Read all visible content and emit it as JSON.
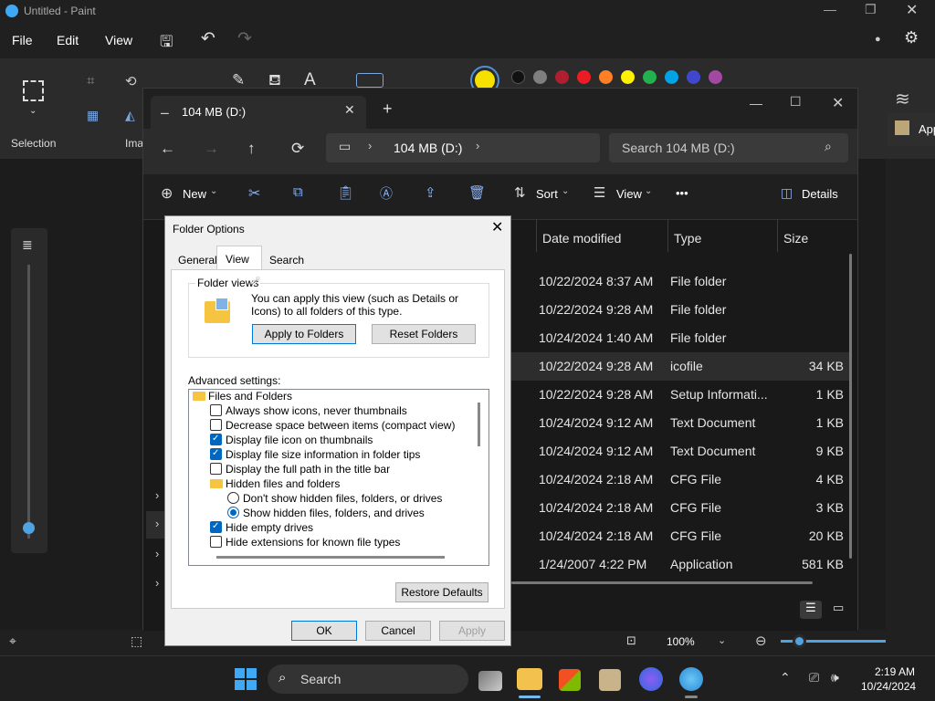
{
  "paint": {
    "title": "Untitled - Paint",
    "menu": [
      "File",
      "Edit",
      "View"
    ],
    "selection_label": "Selection",
    "image_label": "Ima",
    "zoom": "100%",
    "palette": [
      "#111111",
      "#7f7f7f",
      "#b01f2f",
      "#ed1c24",
      "#ff7f27",
      "#fff200",
      "#22b14c",
      "#00a2e8",
      "#3f48cc",
      "#a349a4"
    ],
    "primary_color": "#f5e000",
    "side_label": "App"
  },
  "explorer": {
    "tab_title": "104 MB (D:)",
    "breadcrumb": "104 MB (D:)",
    "search_placeholder": "Search 104 MB (D:)",
    "toolbar": {
      "new": "New",
      "sort": "Sort",
      "view": "View",
      "more": "•••",
      "details": "Details"
    },
    "columns": [
      "Date modified",
      "Type",
      "Size"
    ],
    "rows": [
      {
        "date": "10/22/2024 8:37 AM",
        "type": "File folder",
        "size": ""
      },
      {
        "date": "10/22/2024 9:28 AM",
        "type": "File folder",
        "size": ""
      },
      {
        "date": "10/24/2024 1:40 AM",
        "type": "File folder",
        "size": ""
      },
      {
        "date": "10/22/2024 9:28 AM",
        "type": "icofile",
        "size": "34 KB"
      },
      {
        "date": "10/22/2024 9:28 AM",
        "type": "Setup Informati...",
        "size": "1 KB"
      },
      {
        "date": "10/24/2024 9:12 AM",
        "type": "Text Document",
        "size": "1 KB"
      },
      {
        "date": "10/24/2024 9:12 AM",
        "type": "Text Document",
        "size": "9 KB"
      },
      {
        "date": "10/24/2024 2:18 AM",
        "type": "CFG File",
        "size": "4 KB"
      },
      {
        "date": "10/24/2024 2:18 AM",
        "type": "CFG File",
        "size": "3 KB"
      },
      {
        "date": "10/24/2024 2:18 AM",
        "type": "CFG File",
        "size": "20 KB"
      },
      {
        "date": "1/24/2007 4:22 PM",
        "type": "Application",
        "size": "581 KB"
      }
    ]
  },
  "dialog": {
    "title": "Folder Options",
    "tabs": [
      "General",
      "View",
      "Search"
    ],
    "folder_views_label": "Folder views",
    "folder_views_text": "You can apply this view (such as Details or Icons) to all folders of this type.",
    "apply_to_folders": "Apply to Folders",
    "reset_folders": "Reset Folders",
    "advanced_label": "Advanced settings:",
    "advanced_items": [
      {
        "label": "Files and Folders",
        "kind": "folder"
      },
      {
        "label": "Always show icons, never thumbnails",
        "kind": "checkbox",
        "checked": false
      },
      {
        "label": "Decrease space between items (compact view)",
        "kind": "checkbox",
        "checked": false
      },
      {
        "label": "Display file icon on thumbnails",
        "kind": "checkbox",
        "checked": true
      },
      {
        "label": "Display file size information in folder tips",
        "kind": "checkbox",
        "checked": true
      },
      {
        "label": "Display the full path in the title bar",
        "kind": "checkbox",
        "checked": false
      },
      {
        "label": "Hidden files and folders",
        "kind": "folder"
      },
      {
        "label": "Don't show hidden files, folders, or drives",
        "kind": "radio",
        "checked": false
      },
      {
        "label": "Show hidden files, folders, and drives",
        "kind": "radio",
        "checked": true
      },
      {
        "label": "Hide empty drives",
        "kind": "checkbox",
        "checked": true
      },
      {
        "label": "Hide extensions for known file types",
        "kind": "checkbox",
        "checked": false
      }
    ],
    "restore_defaults": "Restore Defaults",
    "ok": "OK",
    "cancel": "Cancel",
    "apply": "Apply"
  },
  "taskbar": {
    "search": "Search",
    "time": "2:19 AM",
    "date": "10/24/2024"
  }
}
